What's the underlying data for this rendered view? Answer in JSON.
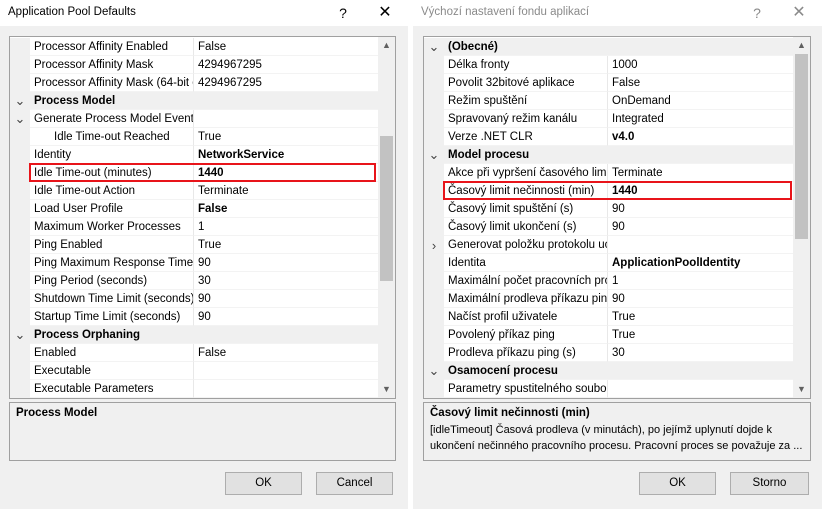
{
  "left": {
    "title": "Application Pool Defaults",
    "help_glyph": "?",
    "close_glyph": "✕",
    "rows": [
      {
        "type": "prop",
        "name": "Processor Affinity Enabled",
        "value": "False"
      },
      {
        "type": "prop",
        "name": "Processor Affinity Mask",
        "value": "4294967295"
      },
      {
        "type": "prop",
        "name": "Processor Affinity Mask (64-bit c",
        "value": "4294967295"
      },
      {
        "type": "cat",
        "name": "Process Model",
        "expander": "expanded"
      },
      {
        "type": "prop",
        "name": "Generate Process Model Event L",
        "value": "",
        "expander": "expanded"
      },
      {
        "type": "sub",
        "name": "Idle Time-out Reached",
        "value": "True"
      },
      {
        "type": "prop",
        "name": "Identity",
        "value": "NetworkService",
        "bold": true
      },
      {
        "type": "prop",
        "name": "Idle Time-out (minutes)",
        "value": "1440",
        "bold": true,
        "highlight": true
      },
      {
        "type": "prop",
        "name": "Idle Time-out Action",
        "value": "Terminate"
      },
      {
        "type": "prop",
        "name": "Load User Profile",
        "value": "False",
        "bold": true
      },
      {
        "type": "prop",
        "name": "Maximum Worker Processes",
        "value": "1"
      },
      {
        "type": "prop",
        "name": "Ping Enabled",
        "value": "True"
      },
      {
        "type": "prop",
        "name": "Ping Maximum Response Time (",
        "value": "90"
      },
      {
        "type": "prop",
        "name": "Ping Period (seconds)",
        "value": "30"
      },
      {
        "type": "prop",
        "name": "Shutdown Time Limit (seconds)",
        "value": "90"
      },
      {
        "type": "prop",
        "name": "Startup Time Limit (seconds)",
        "value": "90"
      },
      {
        "type": "cat",
        "name": "Process Orphaning",
        "expander": "expanded"
      },
      {
        "type": "prop",
        "name": "Enabled",
        "value": "False"
      },
      {
        "type": "prop",
        "name": "Executable",
        "value": ""
      },
      {
        "type": "prop",
        "name": "Executable Parameters",
        "value": ""
      }
    ],
    "scroll_up": "▲",
    "scroll_down": "▼",
    "scroll_position": 0.45,
    "description": {
      "title": "Process Model",
      "text": ""
    },
    "ok_label": "OK",
    "cancel_label": "Cancel"
  },
  "right": {
    "title": "Výchozí nastavení fondu aplikací",
    "help_glyph": "?",
    "close_glyph": "✕",
    "rows": [
      {
        "type": "cat",
        "name": "(Obecné)",
        "expander": "expanded"
      },
      {
        "type": "prop",
        "name": "Délka fronty",
        "value": "1000"
      },
      {
        "type": "prop",
        "name": "Povolit 32bitové aplikace",
        "value": "False"
      },
      {
        "type": "prop",
        "name": "Režim spuštění",
        "value": "OnDemand"
      },
      {
        "type": "prop",
        "name": "Spravovaný režim kanálu",
        "value": "Integrated"
      },
      {
        "type": "prop",
        "name": "Verze .NET CLR",
        "value": "v4.0",
        "bold": true
      },
      {
        "type": "cat",
        "name": "Model procesu",
        "expander": "expanded"
      },
      {
        "type": "prop",
        "name": "Akce při vypršení časového limit",
        "value": "Terminate"
      },
      {
        "type": "prop",
        "name": "Časový limit nečinnosti (min)",
        "value": "1440",
        "bold": true,
        "highlight": true
      },
      {
        "type": "prop",
        "name": "Časový limit spuštění (s)",
        "value": "90"
      },
      {
        "type": "prop",
        "name": "Časový limit ukončení (s)",
        "value": "90"
      },
      {
        "type": "prop",
        "name": "Generovat položku protokolu uc",
        "value": "",
        "expander": "collapsed"
      },
      {
        "type": "prop",
        "name": "Identita",
        "value": "ApplicationPoolIdentity",
        "bold": true
      },
      {
        "type": "prop",
        "name": "Maximální počet pracovních prc",
        "value": "1"
      },
      {
        "type": "prop",
        "name": "Maximální prodleva příkazu ping",
        "value": "90"
      },
      {
        "type": "prop",
        "name": "Načíst profil uživatele",
        "value": "True"
      },
      {
        "type": "prop",
        "name": "Povolený příkaz ping",
        "value": "True"
      },
      {
        "type": "prop",
        "name": "Prodleva příkazu ping (s)",
        "value": "30"
      },
      {
        "type": "cat",
        "name": "Osamocení procesu",
        "expander": "expanded"
      },
      {
        "type": "prop",
        "name": "Parametry spustitelného soubor",
        "value": ""
      }
    ],
    "scroll_up": "▲",
    "scroll_down": "▼",
    "scroll_position": 0.0,
    "description": {
      "title": "Časový limit nečinnosti (min)",
      "text": "[idleTimeout] Časová prodleva (v minutách), po jejímž uplynutí dojde k ukončení nečinného pracovního procesu. Pracovní proces se považuje za ..."
    },
    "ok_label": "OK",
    "cancel_label": "Storno"
  }
}
